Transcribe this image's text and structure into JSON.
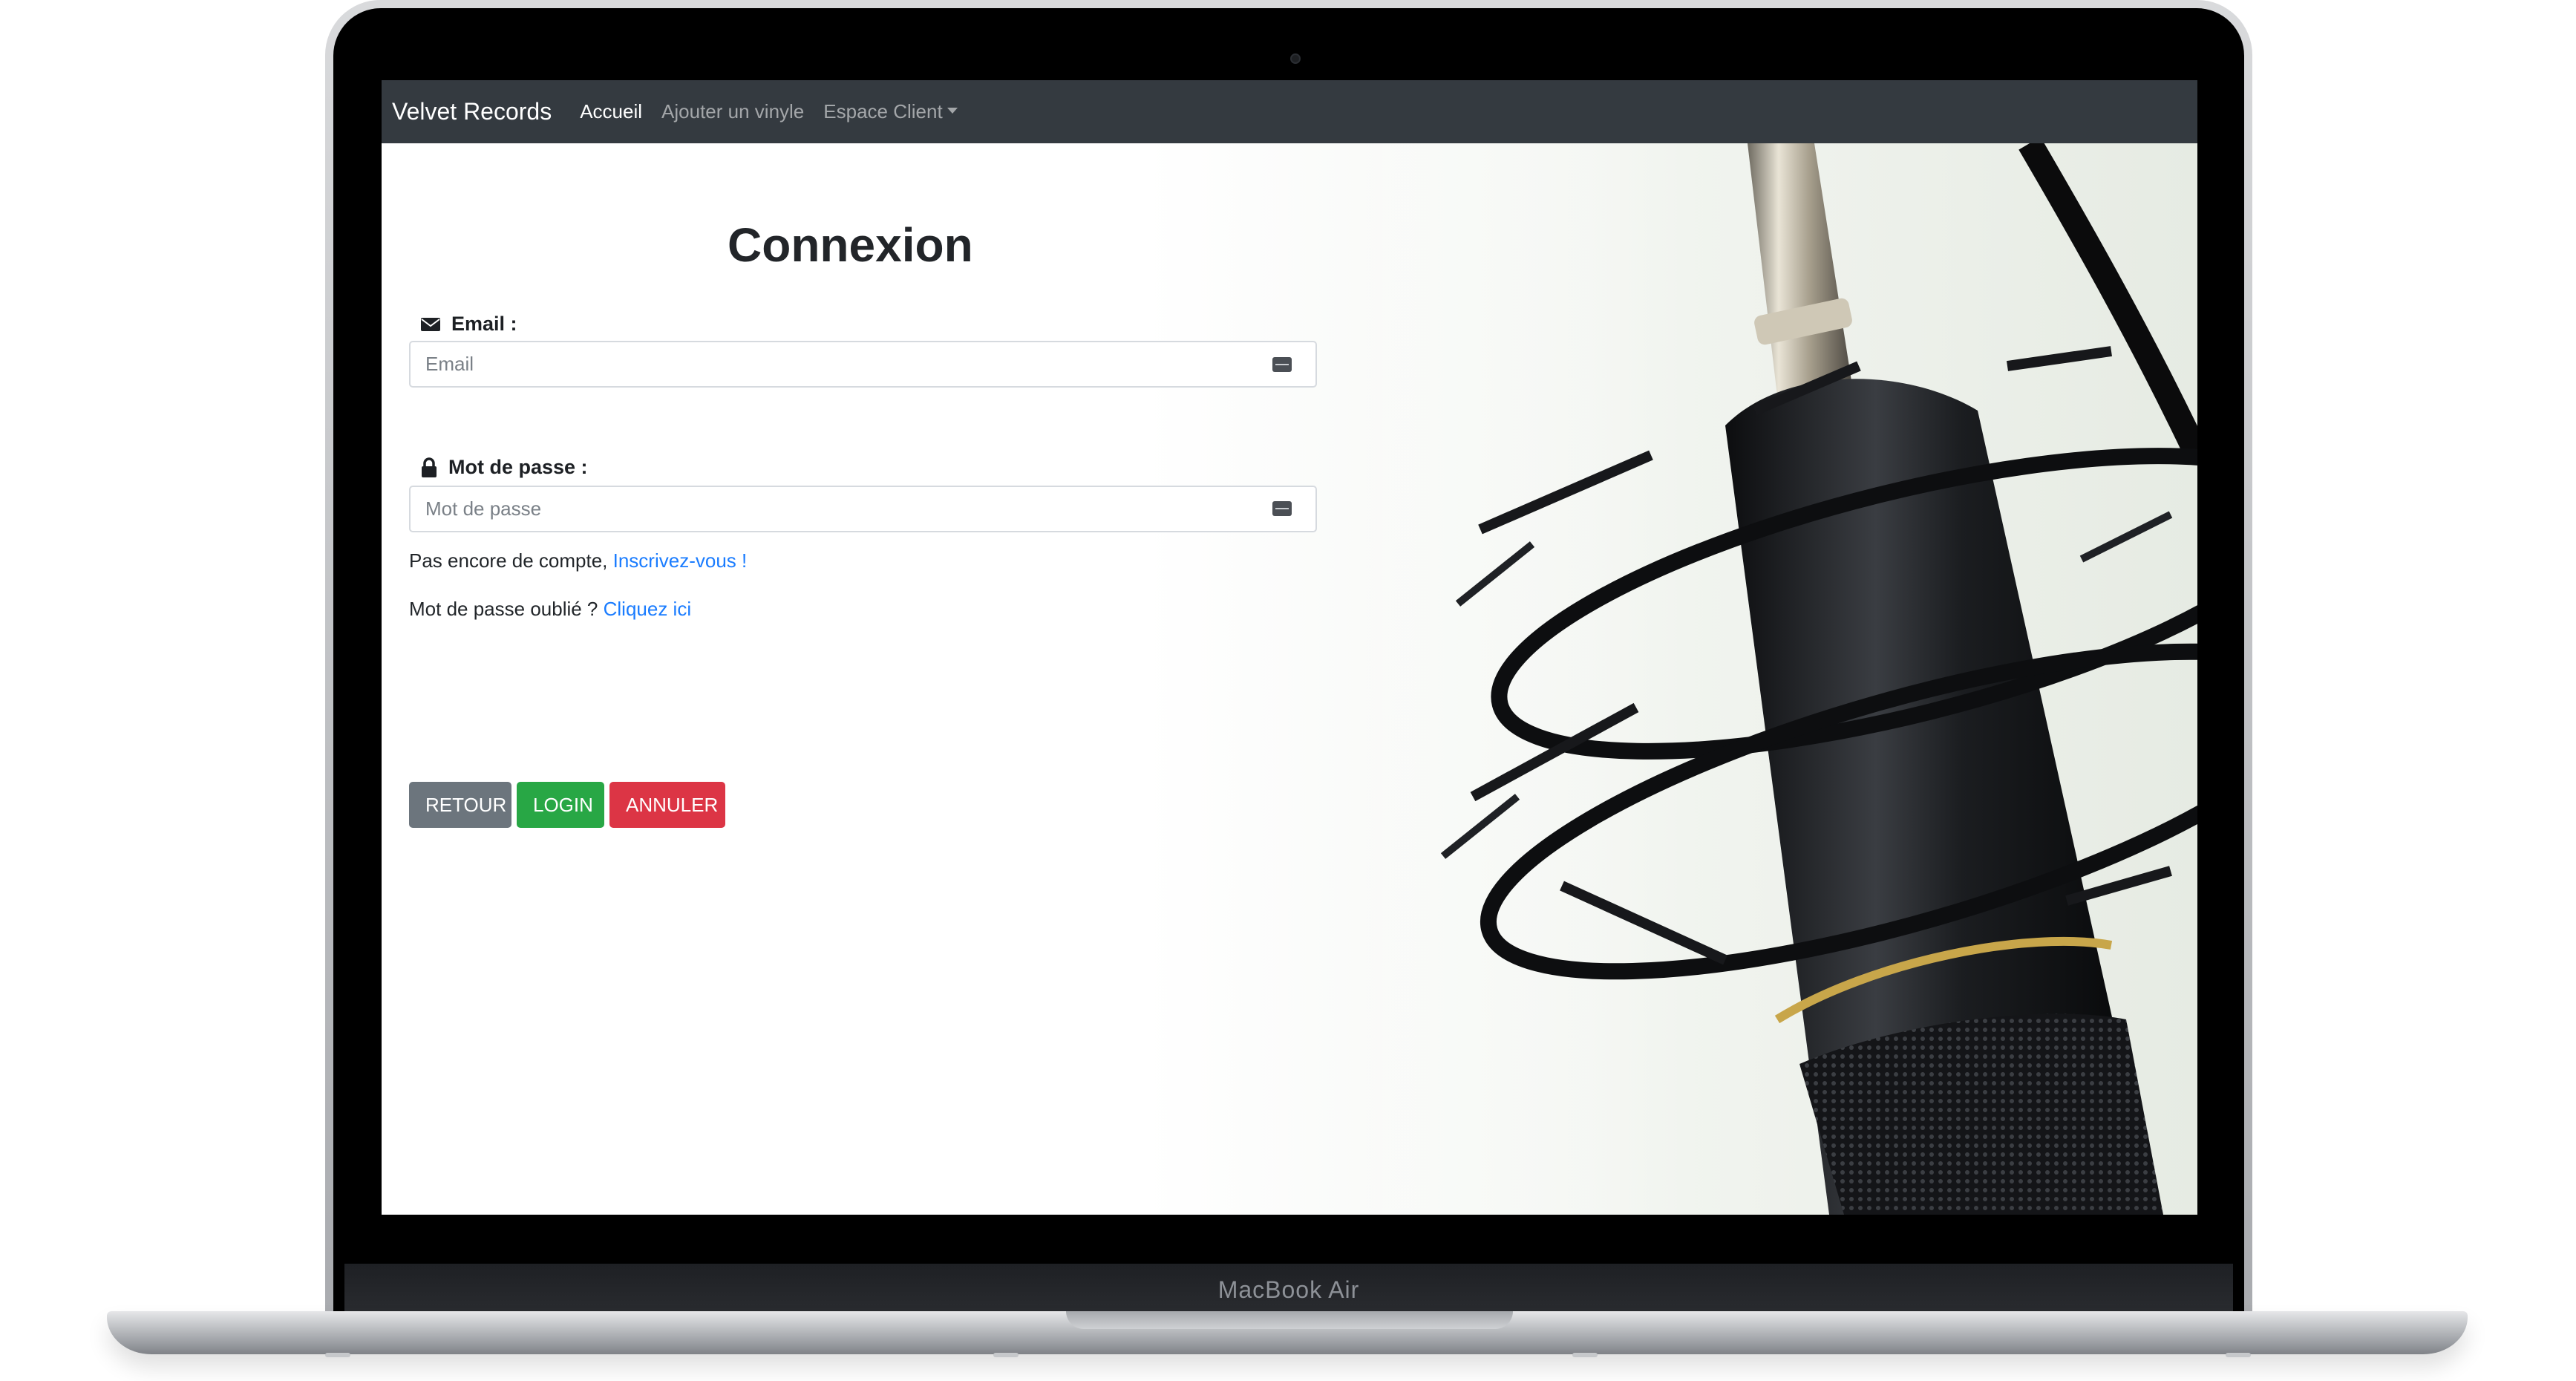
{
  "device": {
    "label": "MacBook Air"
  },
  "navbar": {
    "brand": "Velvet Records",
    "links": [
      {
        "label": "Accueil",
        "active": true
      },
      {
        "label": "Ajouter un vinyle",
        "active": false
      },
      {
        "label": "Espace Client",
        "active": false,
        "dropdown": true
      }
    ]
  },
  "page": {
    "title": "Connexion"
  },
  "form": {
    "email": {
      "label": "Email :",
      "icon": "envelope-icon",
      "value": "",
      "placeholder": "Email"
    },
    "password": {
      "label": "Mot de passe :",
      "icon": "lock-icon",
      "value": "",
      "placeholder": "Mot de passe"
    },
    "signup": {
      "text": "Pas encore de compte,",
      "link": "Inscrivez-vous !"
    },
    "forgot": {
      "text": "Mot de passe oublié ?",
      "link": "Cliquez ici"
    },
    "buttons": {
      "back": "RETOUR",
      "login": "LOGIN",
      "cancel": "ANNULER"
    }
  },
  "colors": {
    "navbar_bg": "#343a40",
    "link": "#1a7cff",
    "btn_secondary": "#6c757d",
    "btn_success": "#28a745",
    "btn_danger": "#dc3545"
  }
}
